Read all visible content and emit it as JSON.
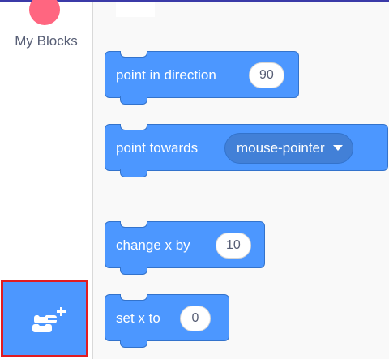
{
  "sidebar": {
    "categories": [
      {
        "label": "My Blocks",
        "color": "#ff6680"
      }
    ],
    "extensions_button": {
      "icon": "add-extension-icon",
      "color": "#4c97ff",
      "highlight_color": "#e11b22"
    }
  },
  "blocks": [
    {
      "label": "point in direction",
      "input": "90",
      "input_type": "number"
    },
    {
      "label": "point towards",
      "input": "mouse-pointer",
      "input_type": "dropdown"
    },
    {
      "label": "change x by",
      "input": "10",
      "input_type": "number"
    },
    {
      "label": "set x to",
      "input": "0",
      "input_type": "number"
    }
  ],
  "colors": {
    "motion_block": "#4c97ff",
    "motion_block_border": "#3373cc",
    "header": "#3b3aa8"
  }
}
